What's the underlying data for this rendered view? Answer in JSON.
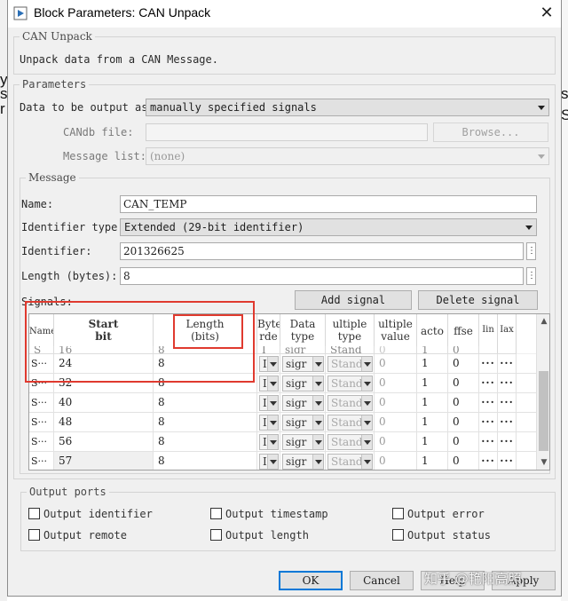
{
  "window": {
    "title": "Block Parameters: CAN Unpack",
    "close_glyph": "✕"
  },
  "background": {
    "left_chars": [
      "y",
      "s",
      "r"
    ],
    "right_chars": [
      "s",
      "S"
    ]
  },
  "description_group": {
    "legend": "CAN Unpack",
    "text": "Unpack data from a CAN Message."
  },
  "parameters": {
    "legend": "Parameters",
    "output_as_label": "Data to be output as:",
    "output_as_value": "manually specified signals",
    "candb_label": "CANdb file:",
    "candb_value": "",
    "browse_label": "Browse...",
    "message_list_label": "Message list:",
    "message_list_value": "(none)"
  },
  "message": {
    "legend": "Message",
    "name_label": "Name:",
    "name_value": "CAN_TEMP",
    "id_type_label": "Identifier type:",
    "id_type_value": "Extended (29-bit identifier)",
    "identifier_label": "Identifier:",
    "identifier_value": "201326625",
    "length_label": "Length (bytes):",
    "length_value": "8",
    "dots": "⋮"
  },
  "signals": {
    "label": "Signals:",
    "add_label": "Add signal",
    "delete_label": "Delete signal",
    "headers": {
      "name": "Name",
      "start_bit_1": "Start",
      "start_bit_2": "bit",
      "length_1": "Length",
      "length_2": "(bits)",
      "byte_order_1": "Byte",
      "byte_order_2": "rde",
      "data_type_1": "Data",
      "data_type_2": "type",
      "multiplex_type_1": "ultiple",
      "multiplex_type_2": "type",
      "multiplex_value_1": "ultiple",
      "multiplex_value_2": "value",
      "factor": "acto",
      "offset": "ffse",
      "min": "Iin",
      "max": "Iax"
    },
    "partial_row": {
      "name": "S",
      "start": "16",
      "length": "8",
      "byte_order": "I",
      "data_type": "sigr",
      "mux_type": "Stand",
      "mux_value": "0",
      "factor": "1",
      "offset": "0"
    },
    "rows": [
      {
        "name": "S···",
        "start": "24",
        "length": "8",
        "byte_order": "I",
        "data_type": "sigr",
        "mux_type": "Stand",
        "mux_value": "0",
        "factor": "1",
        "offset": "0",
        "min": "···",
        "max": "···"
      },
      {
        "name": "S···",
        "start": "32",
        "length": "8",
        "byte_order": "I",
        "data_type": "sigr",
        "mux_type": "Stand",
        "mux_value": "0",
        "factor": "1",
        "offset": "0",
        "min": "···",
        "max": "···"
      },
      {
        "name": "S···",
        "start": "40",
        "length": "8",
        "byte_order": "I",
        "data_type": "sigr",
        "mux_type": "Stand",
        "mux_value": "0",
        "factor": "1",
        "offset": "0",
        "min": "···",
        "max": "···"
      },
      {
        "name": "S···",
        "start": "48",
        "length": "8",
        "byte_order": "I",
        "data_type": "sigr",
        "mux_type": "Stand",
        "mux_value": "0",
        "factor": "1",
        "offset": "0",
        "min": "···",
        "max": "···"
      },
      {
        "name": "S···",
        "start": "56",
        "length": "8",
        "byte_order": "I",
        "data_type": "sigr",
        "mux_type": "Stand",
        "mux_value": "0",
        "factor": "1",
        "offset": "0",
        "min": "···",
        "max": "···"
      },
      {
        "name": "S···",
        "start": "57",
        "length": "8",
        "byte_order": "I",
        "data_type": "sigr",
        "mux_type": "Stand",
        "mux_value": "0",
        "factor": "1",
        "offset": "0",
        "min": "···",
        "max": "···"
      }
    ]
  },
  "output_ports": {
    "legend": "Output ports",
    "checkboxes": [
      {
        "label": "Output identifier",
        "checked": false
      },
      {
        "label": "Output timestamp",
        "checked": false
      },
      {
        "label": "Output error",
        "checked": false
      },
      {
        "label": "Output remote",
        "checked": false
      },
      {
        "label": "Output length",
        "checked": false
      },
      {
        "label": "Output status",
        "checked": false
      }
    ]
  },
  "footer": {
    "ok_label": "OK",
    "cancel_label": "Cancel",
    "help_label": "Help",
    "apply_label": "Apply"
  },
  "watermark": "知乎 @艳阳高照",
  "colors": {
    "highlight": "#e03a2f",
    "focus": "#0078d7",
    "dialog_bg": "#f0f0f0"
  }
}
